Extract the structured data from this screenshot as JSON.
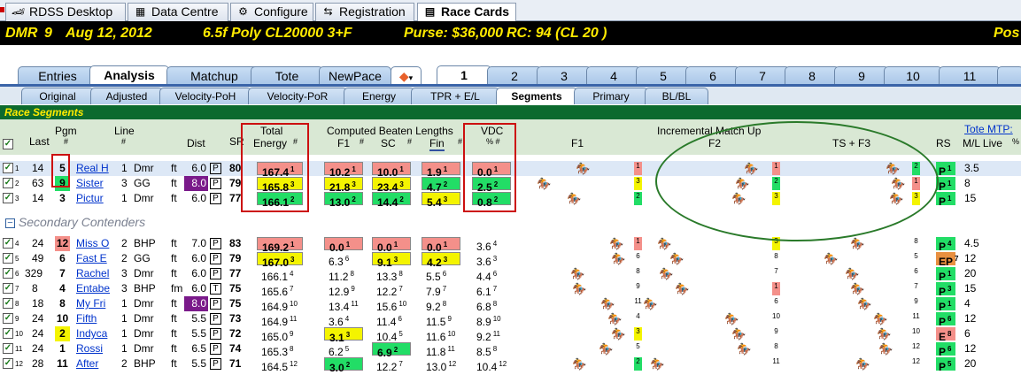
{
  "app_tabs": [
    {
      "label": "RDSS Desktop",
      "icon": "car-icon"
    },
    {
      "label": "Data Centre",
      "icon": "grid-icon"
    },
    {
      "label": "Configure",
      "icon": "gear-icon"
    },
    {
      "label": "Registration",
      "icon": "registration-icon"
    },
    {
      "label": "Race Cards",
      "icon": "racecard-icon"
    }
  ],
  "race_header": {
    "track": "DMR",
    "race": "9",
    "date": "Aug 12, 2012",
    "conditions": "6.5f  Poly  CL20000  3+F",
    "purse": "Purse: $36,000",
    "rc": "RC: 94  (CL 20 )",
    "pos": "Pos"
  },
  "main_tabs": [
    "Entries",
    "Analysis",
    "Matchup",
    "Tote",
    "NewPace",
    "1",
    "2",
    "3",
    "4",
    "5",
    "6",
    "7",
    "8",
    "9",
    "10",
    "11"
  ],
  "sub_tabs": [
    "Original",
    "Adjusted",
    "Velocity-PoH",
    "Velocity-PoR",
    "Energy",
    "TPR + E/L",
    "Segments",
    "Primary",
    "BL/BL"
  ],
  "section_title": "Race Segments",
  "headers": {
    "last": "Last",
    "pgm": "Pgm",
    "pgm_sub": "#",
    "line": "Line",
    "line_sub": "#",
    "dist": "Dist",
    "sr": "SR",
    "total1": "Total",
    "total2": "Energy",
    "total_sub": "#",
    "cbl": "Computed Beaten Lengths",
    "f1": "F1",
    "sc": "SC",
    "fin": "Fin",
    "vdc": "VDC",
    "vdc_sub": "%  #",
    "f1b": "F1",
    "imu": "Incremental Match Up",
    "f2": "F2",
    "tsf3": "TS + F3",
    "rs": "RS",
    "tote": "Tote MTP:",
    "ml": "M/L Live",
    "pct": "%"
  },
  "secondary_label": "Secondary Contenders",
  "rows": [
    {
      "n": "1",
      "last": "14",
      "pgm": "5",
      "name": "Real H",
      "line": "1",
      "sf": "Dmr",
      "surf": "ft",
      "dist": "6.0",
      "dbox": "P",
      "sr": "80",
      "te": "167.4",
      "ter": "1",
      "f1": "10.2",
      "f1r": "1",
      "sc": "10.0",
      "scr": "1",
      "fin": "1.9",
      "finr": "1",
      "vdc": "0.0",
      "vdcr": "1",
      "rk1": "1",
      "rk2": "1",
      "rk3": "2",
      "rs": "P",
      "rsr": "1",
      "ml": "3.5"
    },
    {
      "n": "2",
      "last": "63",
      "pgm": "9",
      "name": "Sister",
      "line": "3",
      "sf": "GG",
      "surf": "ft",
      "dist": "8.0",
      "dbox": "P",
      "sr": "79",
      "te": "165.8",
      "ter": "3",
      "f1": "21.8",
      "f1r": "3",
      "sc": "23.4",
      "scr": "3",
      "fin": "4.7",
      "finr": "2",
      "vdc": "2.5",
      "vdcr": "2",
      "rk1": "3",
      "rk2": "2",
      "rk3": "1",
      "rs": "P",
      "rsr": "1",
      "ml": "8"
    },
    {
      "n": "3",
      "last": "14",
      "pgm": "3",
      "name": "Pictur",
      "line": "1",
      "sf": "Dmr",
      "surf": "ft",
      "dist": "6.0",
      "dbox": "P",
      "sr": "77",
      "te": "166.1",
      "ter": "2",
      "f1": "13.0",
      "f1r": "2",
      "sc": "14.4",
      "scr": "2",
      "fin": "5.4",
      "finr": "3",
      "vdc": "0.8",
      "vdcr": "2",
      "rk1": "2",
      "rk2": "3",
      "rk3": "3",
      "rs": "P",
      "rsr": "1",
      "ml": "15"
    },
    {
      "n": "4",
      "last": "24",
      "pgm": "12",
      "name": "Miss O",
      "line": "2",
      "sf": "BHP",
      "surf": "ft",
      "dist": "7.0",
      "dbox": "P",
      "sr": "83",
      "te": "169.2",
      "ter": "1",
      "f1": "0.0",
      "f1r": "1",
      "sc": "0.0",
      "scr": "1",
      "fin": "0.0",
      "finr": "1",
      "vdc": "3.6",
      "vdcr": "4",
      "rk1": "1",
      "rk2": "3",
      "rk3": "8",
      "rs": "P",
      "rsr": "4",
      "ml": "4.5"
    },
    {
      "n": "5",
      "last": "49",
      "pgm": "6",
      "name": "Fast E",
      "line": "2",
      "sf": "GG",
      "surf": "ft",
      "dist": "6.0",
      "dbox": "P",
      "sr": "79",
      "te": "167.0",
      "ter": "3",
      "f1": "6.3",
      "f1r": "6",
      "sc": "9.1",
      "scr": "3",
      "fin": "4.2",
      "finr": "3",
      "vdc": "3.6",
      "vdcr": "3",
      "rk1": "6",
      "rk2": "8",
      "rk3": "5",
      "rs": "EP",
      "rsr": "7",
      "ml": "12"
    },
    {
      "n": "6",
      "last": "329",
      "pgm": "7",
      "name": "Rachel",
      "line": "3",
      "sf": "Dmr",
      "surf": "ft",
      "dist": "6.0",
      "dbox": "P",
      "sr": "77",
      "te": "166.1",
      "ter": "4",
      "f1": "11.2",
      "f1r": "8",
      "sc": "13.3",
      "scr": "8",
      "fin": "5.5",
      "finr": "6",
      "vdc": "4.4",
      "vdcr": "6",
      "rk1": "8",
      "rk2": "7",
      "rk3": "6",
      "rs": "P",
      "rsr": "1",
      "ml": "20"
    },
    {
      "n": "7",
      "last": "8",
      "pgm": "4",
      "name": "Entabe",
      "line": "3",
      "sf": "BHP",
      "surf": "fm",
      "dist": "6.0",
      "dbox": "T",
      "sr": "75",
      "te": "165.6",
      "ter": "7",
      "f1": "12.9",
      "f1r": "9",
      "sc": "12.2",
      "scr": "7",
      "fin": "7.9",
      "finr": "7",
      "vdc": "6.1",
      "vdcr": "7",
      "rk1": "9",
      "rk2": "1",
      "rk3": "7",
      "rs": "P",
      "rsr": "3",
      "ml": "15"
    },
    {
      "n": "8",
      "last": "18",
      "pgm": "8",
      "name": "My Fri",
      "line": "1",
      "sf": "Dmr",
      "surf": "ft",
      "dist": "8.0",
      "dbox": "P",
      "sr": "75",
      "te": "164.9",
      "ter": "10",
      "f1": "13.4",
      "f1r": "11",
      "sc": "15.6",
      "scr": "10",
      "fin": "9.2",
      "finr": "8",
      "vdc": "6.8",
      "vdcr": "8",
      "rk1": "11",
      "rk2": "6",
      "rk3": "9",
      "rs": "P",
      "rsr": "1",
      "ml": "4"
    },
    {
      "n": "9",
      "last": "24",
      "pgm": "10",
      "name": "Fifth",
      "line": "1",
      "sf": "Dmr",
      "surf": "ft",
      "dist": "5.5",
      "dbox": "P",
      "sr": "73",
      "te": "164.9",
      "ter": "11",
      "f1": "3.6",
      "f1r": "4",
      "sc": "11.4",
      "scr": "6",
      "fin": "11.5",
      "finr": "9",
      "vdc": "8.9",
      "vdcr": "10",
      "rk1": "4",
      "rk2": "10",
      "rk3": "11",
      "rs": "P",
      "rsr": "6",
      "ml": "12"
    },
    {
      "n": "10",
      "last": "24",
      "pgm": "2",
      "name": "Indyca",
      "line": "1",
      "sf": "Dmr",
      "surf": "ft",
      "dist": "5.5",
      "dbox": "P",
      "sr": "72",
      "te": "165.0",
      "ter": "9",
      "f1": "3.1",
      "f1r": "3",
      "sc": "10.4",
      "scr": "5",
      "fin": "11.6",
      "finr": "10",
      "vdc": "9.2",
      "vdcr": "11",
      "rk1": "3",
      "rk2": "9",
      "rk3": "10",
      "rs": "E",
      "rsr": "8",
      "ml": "6"
    },
    {
      "n": "11",
      "last": "24",
      "pgm": "1",
      "name": "Rossi",
      "line": "1",
      "sf": "Dmr",
      "surf": "ft",
      "dist": "6.5",
      "dbox": "P",
      "sr": "74",
      "te": "165.3",
      "ter": "8",
      "f1": "6.2",
      "f1r": "5",
      "sc": "6.9",
      "scr": "2",
      "fin": "11.8",
      "finr": "11",
      "vdc": "8.5",
      "vdcr": "8",
      "rk1": "5",
      "rk2": "8",
      "rk3": "12",
      "rs": "P",
      "rsr": "6",
      "ml": "12"
    },
    {
      "n": "12",
      "last": "28",
      "pgm": "11",
      "name": "After",
      "line": "2",
      "sf": "BHP",
      "surf": "ft",
      "dist": "5.5",
      "dbox": "P",
      "sr": "71",
      "te": "164.5",
      "ter": "12",
      "f1": "3.0",
      "f1r": "2",
      "sc": "12.2",
      "scr": "7",
      "fin": "13.0",
      "finr": "12",
      "vdc": "10.4",
      "vdcr": "12",
      "rk1": "2",
      "rk2": "11",
      "rk3": "12",
      "rs": "P",
      "rsr": "5",
      "ml": "20"
    }
  ]
}
